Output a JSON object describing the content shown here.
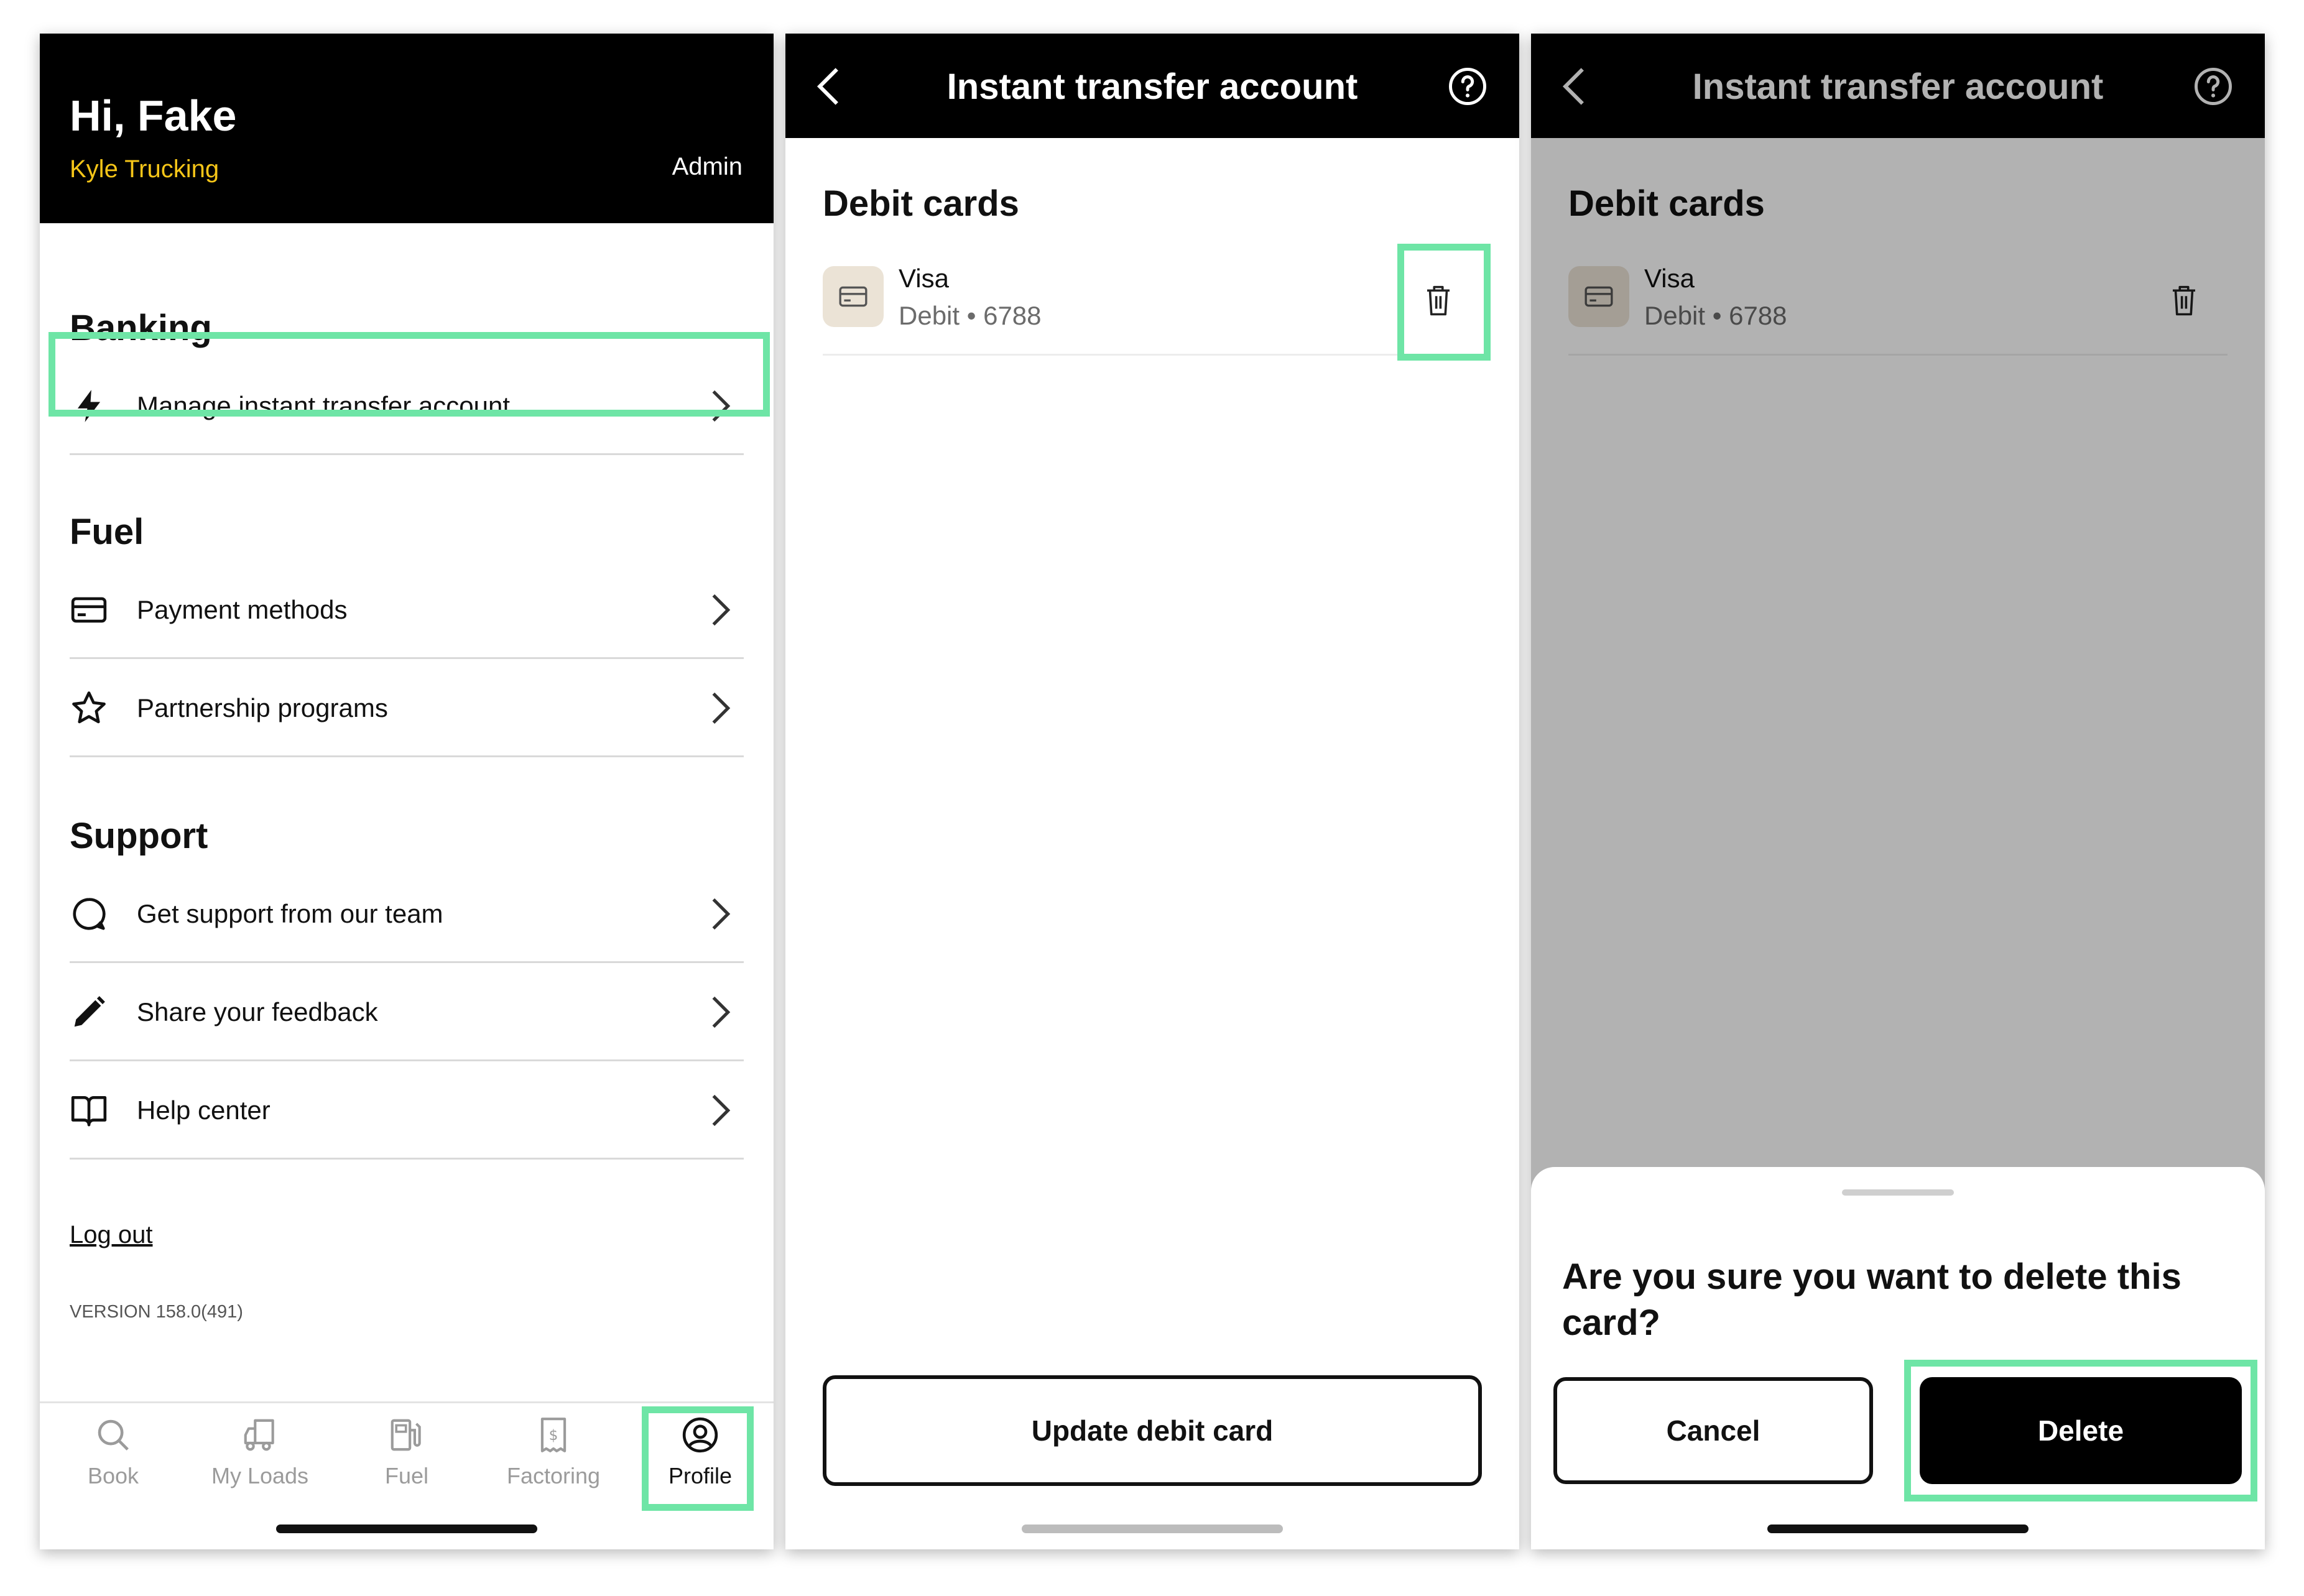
{
  "profile_screen": {
    "greeting": "Hi, Fake",
    "company": "Kyle Trucking",
    "role": "Admin",
    "sections": {
      "banking": {
        "title": "Banking",
        "items": [
          {
            "label": "Manage instant transfer account",
            "icon": "lightning-bolt-icon"
          }
        ]
      },
      "fuel": {
        "title": "Fuel",
        "items": [
          {
            "label": "Payment methods",
            "icon": "credit-card-icon"
          },
          {
            "label": "Partnership programs",
            "icon": "star-icon"
          }
        ]
      },
      "support": {
        "title": "Support",
        "items": [
          {
            "label": "Get support from our team",
            "icon": "chat-bubble-icon"
          },
          {
            "label": "Share your feedback",
            "icon": "pencil-icon"
          },
          {
            "label": "Help center",
            "icon": "open-book-icon"
          }
        ]
      }
    },
    "logout": "Log out",
    "version": "VERSION 158.0(491)",
    "tabs": [
      {
        "label": "Book",
        "icon": "search-icon",
        "active": false
      },
      {
        "label": "My Loads",
        "icon": "truck-icon",
        "active": false
      },
      {
        "label": "Fuel",
        "icon": "fuel-pump-icon",
        "active": false
      },
      {
        "label": "Factoring",
        "icon": "receipt-dollar-icon",
        "active": false
      },
      {
        "label": "Profile",
        "icon": "user-circle-icon",
        "active": true
      }
    ]
  },
  "transfer_screen": {
    "title": "Instant transfer account",
    "section": "Debit cards",
    "card": {
      "name": "Visa",
      "detail": "Debit • 6788"
    },
    "update_button": "Update debit card"
  },
  "confirm_screen": {
    "title": "Instant transfer account",
    "section": "Debit cards",
    "card": {
      "name": "Visa",
      "detail": "Debit • 6788"
    },
    "question": "Are you sure you want to delete this card?",
    "cancel_button": "Cancel",
    "delete_button": "Delete"
  },
  "colors": {
    "highlight": "#6ee5a6",
    "company_text": "#f5c518",
    "header_bg": "#000000",
    "card_tile": "#ebe3d6"
  }
}
